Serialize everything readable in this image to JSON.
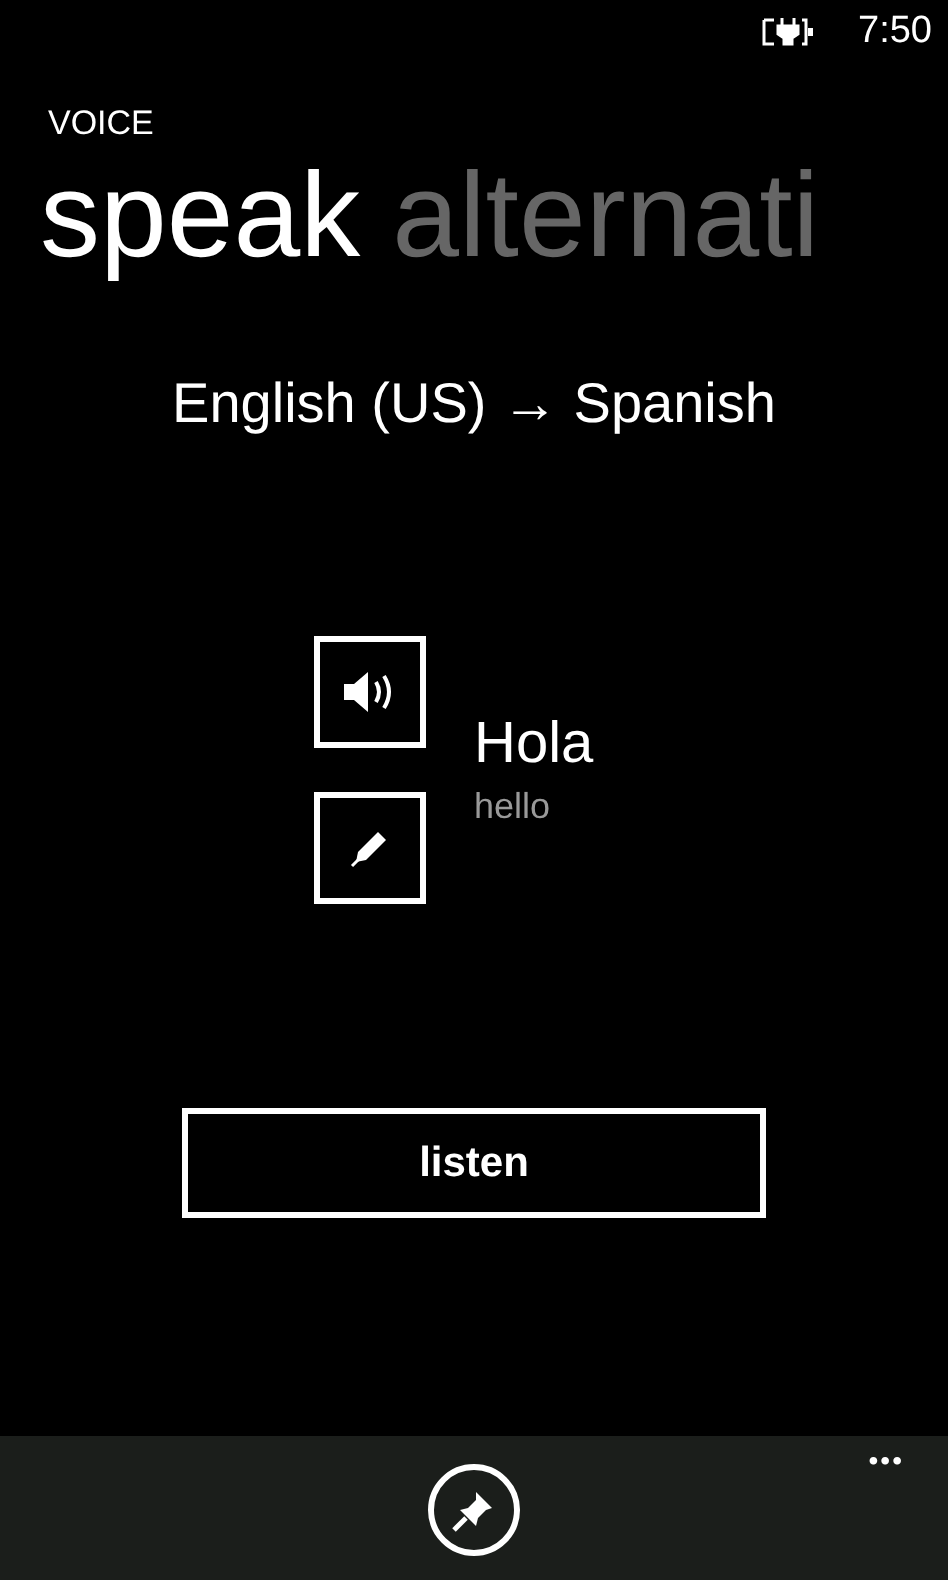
{
  "status_bar": {
    "time": "7:50"
  },
  "app_title": "VOICE",
  "pivot": [
    {
      "label": "speak",
      "selected": true
    },
    {
      "label": "alternati",
      "selected": false
    }
  ],
  "language_pair": "English (US) → Spanish",
  "translation": {
    "text": "Hola",
    "source": "hello"
  },
  "listen_button": "listen",
  "app_bar": {
    "more": "•••"
  }
}
